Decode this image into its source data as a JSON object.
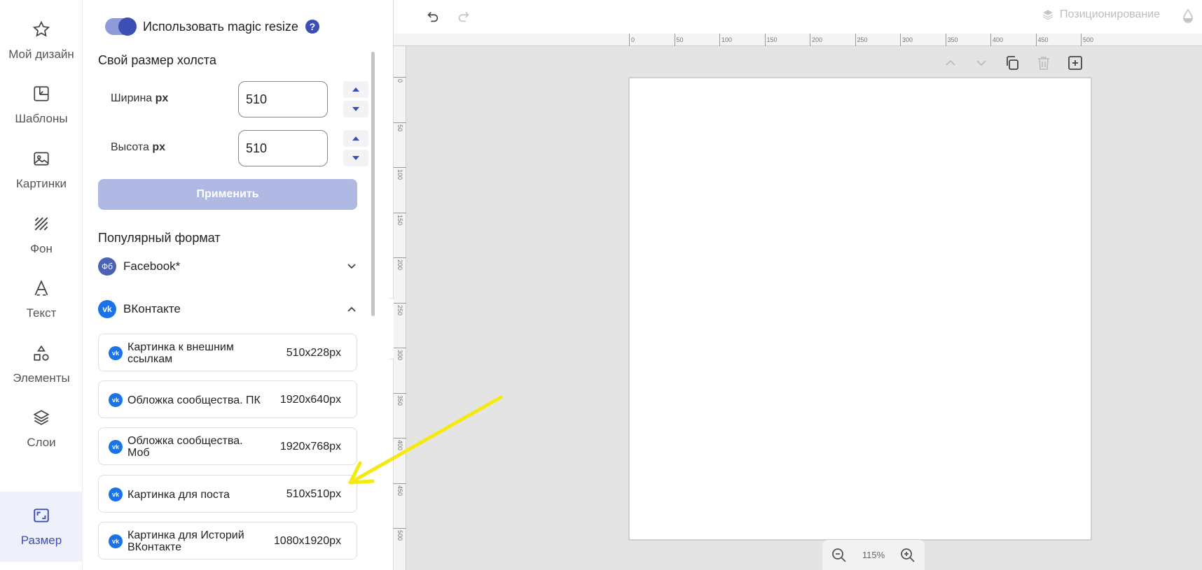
{
  "rail": {
    "items": [
      {
        "label": "Мой дизайн",
        "icon": "star-icon"
      },
      {
        "label": "Шаблоны",
        "icon": "template-icon"
      },
      {
        "label": "Картинки",
        "icon": "image-icon"
      },
      {
        "label": "Фон",
        "icon": "background-icon"
      },
      {
        "label": "Текст",
        "icon": "text-icon"
      },
      {
        "label": "Элементы",
        "icon": "shapes-icon"
      },
      {
        "label": "Слои",
        "icon": "layers-icon"
      },
      {
        "label": "Размер",
        "icon": "resize-icon"
      }
    ],
    "active_index": 7,
    "accent": "#3d4fb5"
  },
  "panel": {
    "magic_resize_label": "Использовать magic resize",
    "magic_resize_on": true,
    "help_glyph": "?",
    "custom_size_title": "Свой размер холста",
    "width_label": "Ширина",
    "height_label": "Высота",
    "unit": "px",
    "width_value": "510",
    "height_value": "510",
    "apply_label": "Применить",
    "popular_title": "Популярный формат",
    "facebook_badge": "Фб",
    "facebook_name": "Facebook*",
    "vk_name": "ВКонтакте",
    "formats": [
      {
        "name": "Картинка к внешним ссылкам",
        "size": "510x228px"
      },
      {
        "name": "Обложка сообщества. ПК",
        "size": "1920x640px"
      },
      {
        "name": "Обложка сообщества. Моб",
        "size": "1920x768px"
      },
      {
        "name": "Картинка для поста",
        "size": "510x510px"
      },
      {
        "name": "Картинка для Историй ВКонтакте",
        "size": "1080x1920px"
      }
    ]
  },
  "topbar": {
    "positioning_label": "Позиционирование"
  },
  "ruler": {
    "h_ticks": [
      "0",
      "50",
      "100",
      "150",
      "200",
      "250",
      "300",
      "350",
      "400",
      "450",
      "500"
    ],
    "v_ticks": [
      "0",
      "50",
      "100",
      "150",
      "200",
      "250",
      "300",
      "350",
      "400",
      "450",
      "500"
    ]
  },
  "zoom": {
    "value": "115%"
  },
  "colors": {
    "accent": "#3d4fb5",
    "vk": "#1a73e8",
    "annotation_arrow": "#f5ea0f"
  }
}
